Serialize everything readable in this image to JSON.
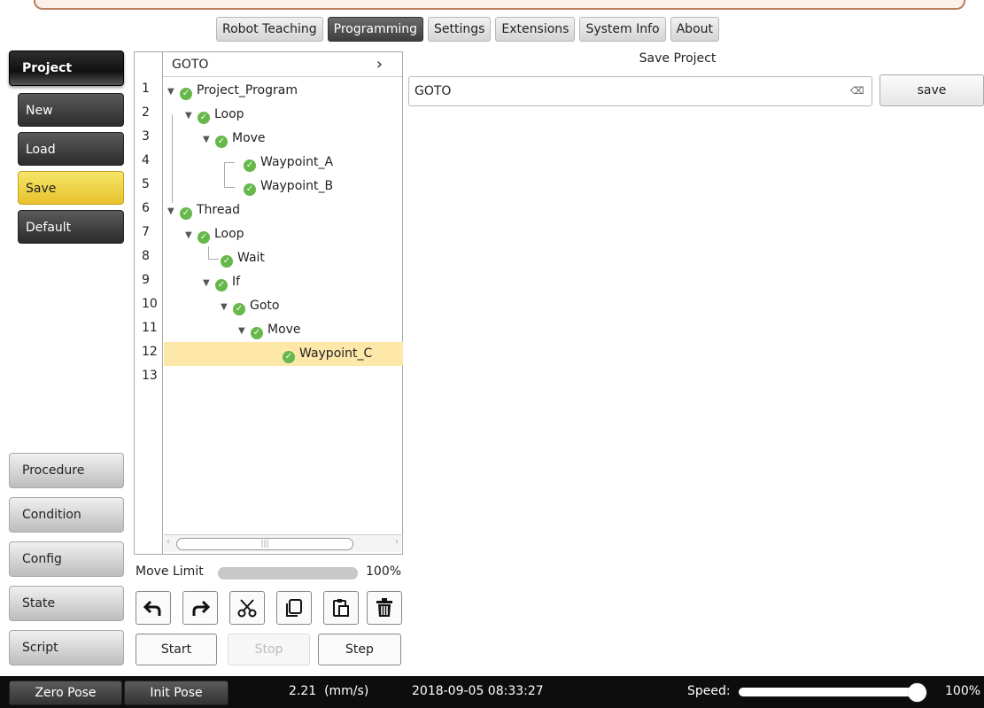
{
  "tabs": [
    "Robot Teaching",
    "Programming",
    "Settings",
    "Extensions",
    "System Info",
    "About"
  ],
  "active_tab": "Programming",
  "sidebar": {
    "project": "Project",
    "new": "New",
    "load": "Load",
    "save": "Save",
    "default": "Default",
    "procedure": "Procedure",
    "condition": "Condition",
    "config": "Config",
    "state": "State",
    "script": "Script"
  },
  "tree": {
    "header": "GOTO",
    "line_numbers": [
      "1",
      "2",
      "3",
      "4",
      "5",
      "6",
      "7",
      "8",
      "9",
      "10",
      "11",
      "12",
      "13"
    ],
    "nodes": [
      {
        "label": "Project_Program"
      },
      {
        "label": "Loop"
      },
      {
        "label": "Move"
      },
      {
        "label": "Waypoint_A"
      },
      {
        "label": "Waypoint_B"
      },
      {
        "label": "Thread"
      },
      {
        "label": "Loop"
      },
      {
        "label": "Wait"
      },
      {
        "label": "If"
      },
      {
        "label": "Goto"
      },
      {
        "label": "Move"
      },
      {
        "label": "Waypoint_C"
      }
    ],
    "selected_line": "12"
  },
  "move_limit": {
    "label": "Move Limit",
    "value": "100%",
    "fraction": 1.0
  },
  "controls": {
    "start": "Start",
    "stop": "Stop",
    "step": "Step"
  },
  "save_panel": {
    "title": "Save Project",
    "input_value": "GOTO",
    "save_button": "save"
  },
  "status": {
    "zero_pose": "Zero Pose",
    "init_pose": "Init Pose",
    "speed_reading": "2.21  (mm/s)",
    "datetime": "2018-09-05 08:33:27",
    "speed_label": "Speed:",
    "speed_value": "100%",
    "speed_fraction": 1.0
  },
  "colors": {
    "accent_save": "#e8c22c",
    "selection": "#fde7a9",
    "check": "#66b84b"
  }
}
